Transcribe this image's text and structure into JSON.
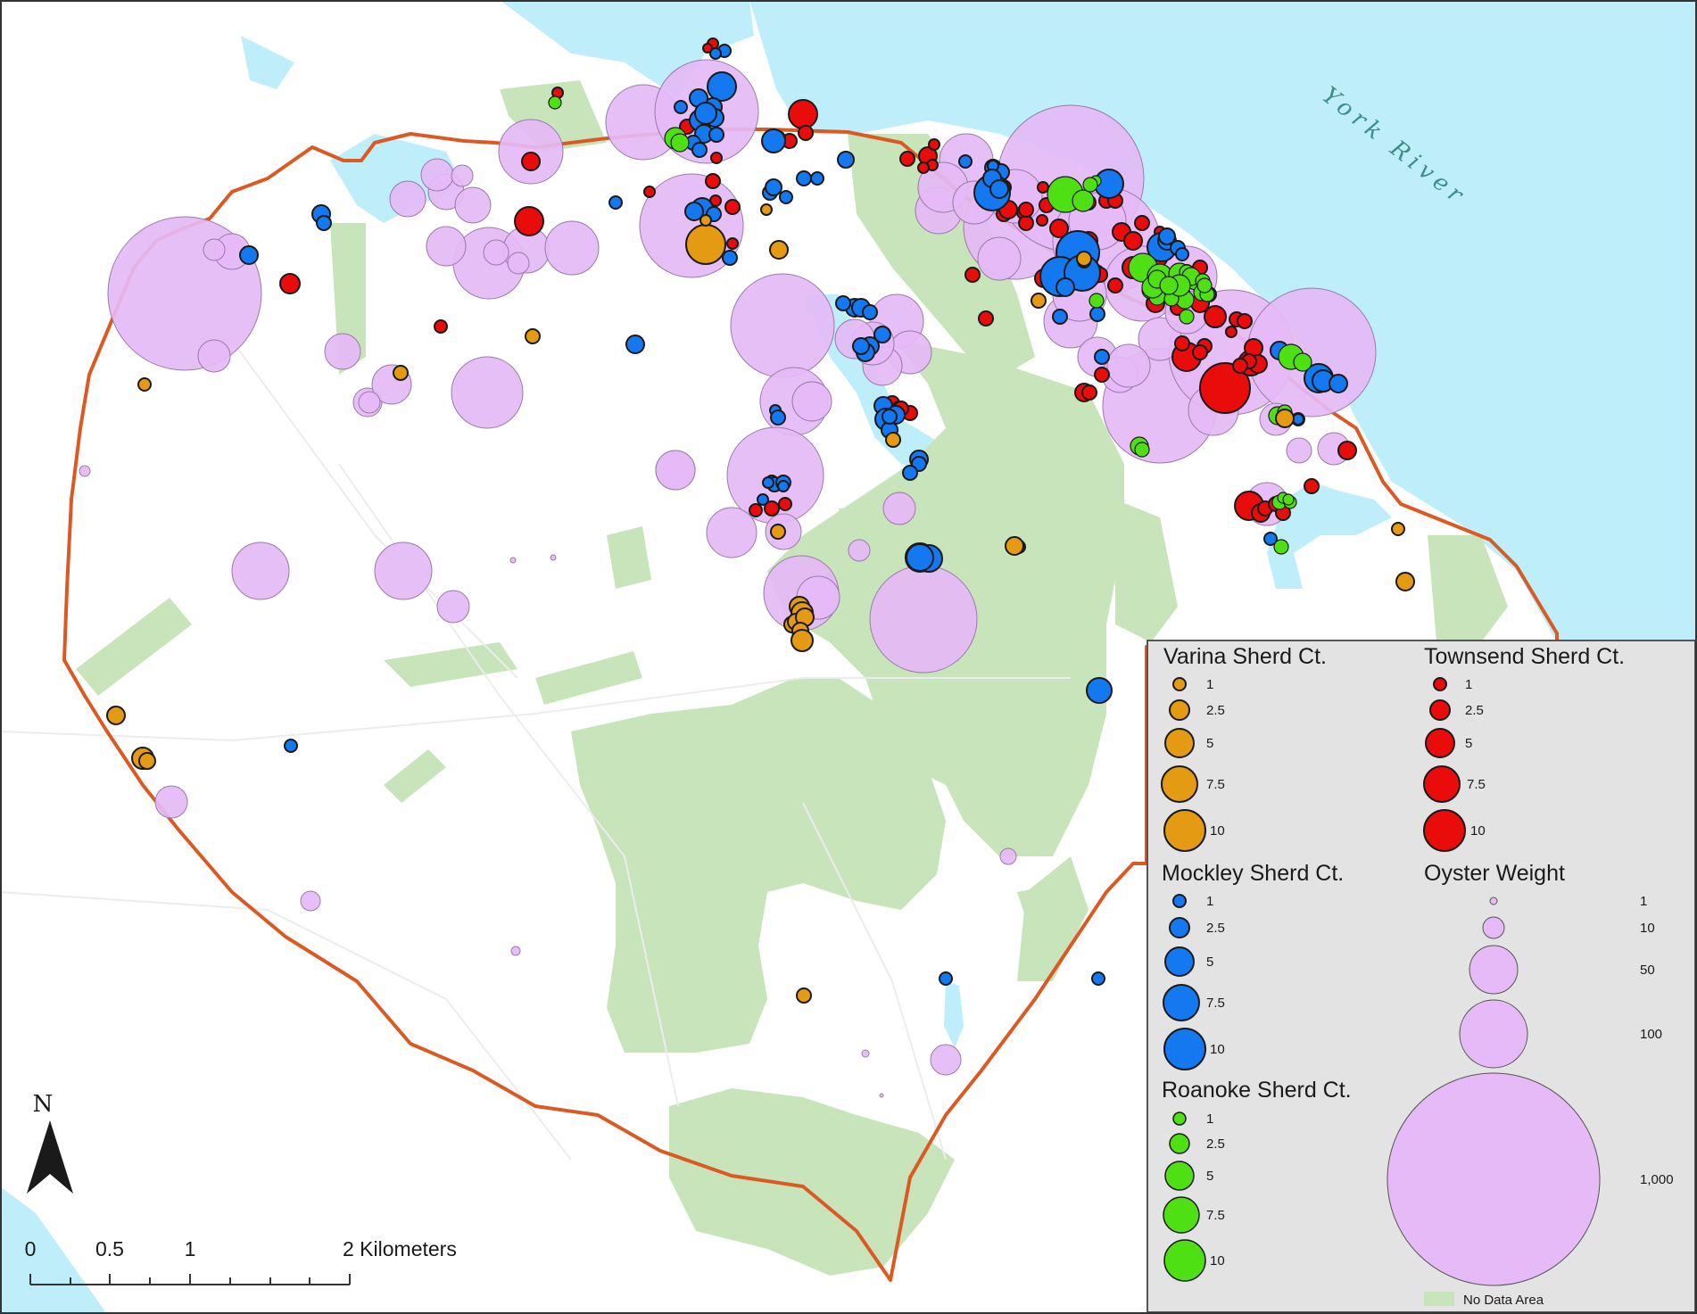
{
  "river_label": "York River",
  "north_label": "N",
  "scale": {
    "ticks": [
      "0",
      "0.5",
      "1",
      "2 Kilometers"
    ]
  },
  "colors": {
    "water": "#bfeefb",
    "no_data": "#c8e4bb",
    "boundary": "#dc5a22",
    "oyster": "#e5baf6",
    "varina": "#e49a12",
    "townsend": "#ea0b0b",
    "mockley": "#1478f0",
    "roanoke": "#4fe014",
    "legend_bg": "#e3e3e3"
  },
  "legend": {
    "varina": {
      "title": "Varina Sherd Ct.",
      "values": [
        "1",
        "2.5",
        "5",
        "7.5",
        "10"
      ]
    },
    "townsend": {
      "title": "Townsend Sherd Ct.",
      "values": [
        "1",
        "2.5",
        "5",
        "7.5",
        "10"
      ]
    },
    "mockley": {
      "title": "Mockley Sherd Ct.",
      "values": [
        "1",
        "2.5",
        "5",
        "7.5",
        "10"
      ]
    },
    "roanoke": {
      "title": "Roanoke Sherd Ct.",
      "values": [
        "1",
        "2.5",
        "5",
        "7.5",
        "10"
      ]
    },
    "oyster": {
      "title": "Oyster Weight",
      "values": [
        "1",
        "10",
        "50",
        "100",
        "1,000"
      ]
    },
    "no_data": "No Data Area"
  }
}
